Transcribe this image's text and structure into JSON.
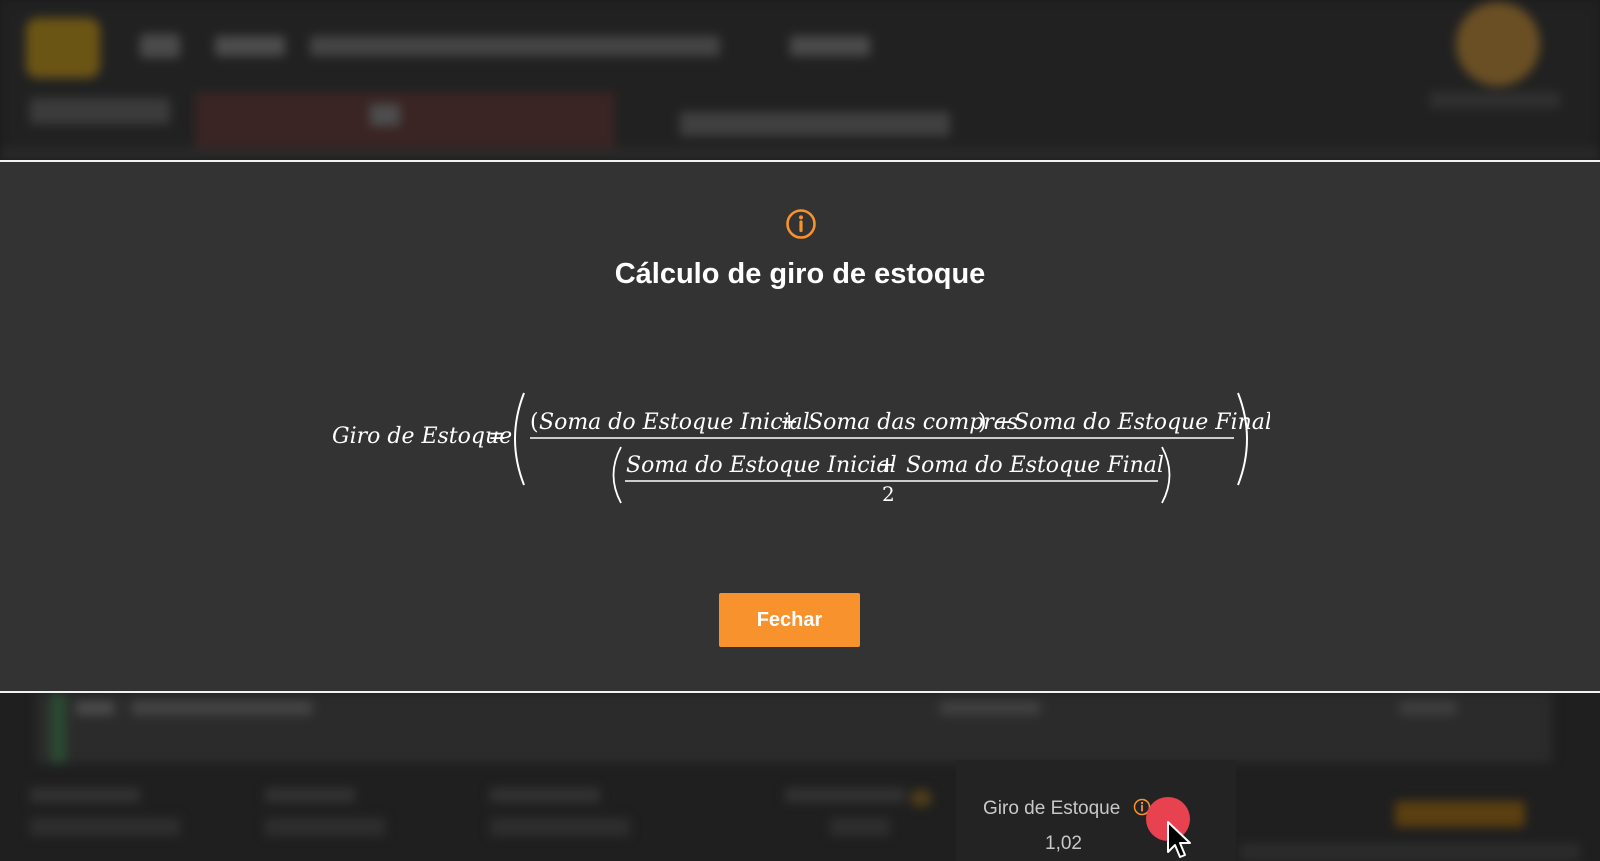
{
  "modal": {
    "icon": "info-icon",
    "title": "Cálculo de giro de estoque",
    "close_label": "Fechar",
    "formula": {
      "lhs": "Giro de Estoque",
      "equals": "=",
      "numerator": {
        "open": "(",
        "term_initial": "Soma do Estoque Inicial",
        "plus": "+",
        "term_purchases": "Soma das compras",
        "close": ")",
        "minus": "−",
        "term_final": "Soma do Estoque Final"
      },
      "denominator": {
        "term_initial": "Soma do Estoque Inicial",
        "plus": "+",
        "term_final": "Soma do Estoque Final",
        "divisor": "2"
      }
    }
  },
  "kpi": {
    "label": "Giro de Estoque",
    "value": "1,02",
    "icon": "info-icon"
  },
  "colors": {
    "accent": "#f7922d",
    "modal_bg": "#333333",
    "title": "#ffffff"
  }
}
